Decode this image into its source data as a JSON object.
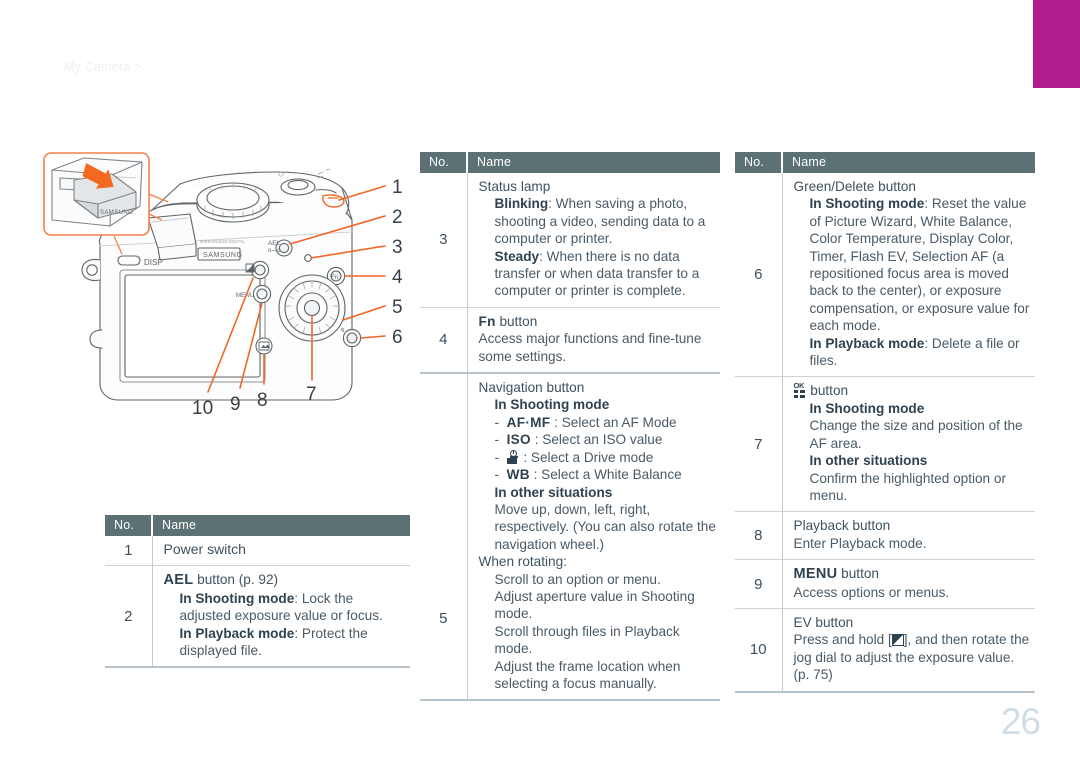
{
  "header": {
    "breadcrumb": "My Camera >"
  },
  "page_number": "26",
  "colors": {
    "accent": "#b01b8e",
    "table_header": "#5c7173",
    "callout": "#f06724",
    "page_num": "#cfdde6"
  },
  "illustration": {
    "name": "camera-rear-view-diagram",
    "brand_label": "SAMSUNG",
    "inset_brand_label": "SAMSUNG",
    "body_labels": [
      "AEL",
      "DISP",
      "MENU",
      "Fn"
    ],
    "callouts": [
      "1",
      "2",
      "3",
      "4",
      "5",
      "6",
      "7",
      "8",
      "9",
      "10"
    ]
  },
  "tables": {
    "columns": {
      "no": "No.",
      "name": "Name"
    },
    "left": {
      "name": "bottom-left-table",
      "rows": [
        {
          "no": "1",
          "title": "Power switch",
          "lines": []
        },
        {
          "no": "2",
          "title_kw": "AEL",
          "title_rest": " button (p. 92)",
          "lines": [
            {
              "label": "In Shooting mode",
              "text": ": Lock the adjusted exposure value or focus."
            },
            {
              "label": "In Playback mode",
              "text": ": Protect the displayed file."
            }
          ]
        }
      ]
    },
    "middle": {
      "name": "middle-table",
      "rows": [
        {
          "no": "3",
          "title": "Status lamp",
          "lines": [
            {
              "label": "Blinking",
              "text": ": When saving a photo, shooting a video, sending data to a computer or printer."
            },
            {
              "label": "Steady",
              "text": ": When there is no data transfer or when data transfer to a computer or printer is complete."
            }
          ]
        },
        {
          "no": "4",
          "title_kw": "Fn",
          "title_rest": " button",
          "lines": [
            {
              "label": "",
              "text": "Access major functions and fine-tune some settings."
            }
          ]
        },
        {
          "no": "5",
          "title": "Navigation button",
          "groups": [
            {
              "heading": "In Shooting mode",
              "bullets": [
                {
                  "kw": "AF·MF",
                  "text": " : Select an AF Mode"
                },
                {
                  "kw": "ISO",
                  "text": " : Select an ISO value"
                },
                {
                  "kw": "__DRIVE_ICON__",
                  "text": " : Select a Drive mode"
                },
                {
                  "kw": "WB",
                  "text": " : Select a White Balance"
                }
              ]
            },
            {
              "heading": "In other situations",
              "text": "Move up, down, left, right, respectively. (You can also rotate the navigation wheel.)"
            },
            {
              "heading_plain": "When rotating:",
              "items": [
                "Scroll to an option or menu.",
                "Adjust aperture value in Shooting mode.",
                "Scroll through files in Playback mode.",
                "Adjust the frame location when selecting a focus manually."
              ]
            }
          ]
        }
      ]
    },
    "right": {
      "name": "right-table",
      "rows": [
        {
          "no": "6",
          "title": "Green/Delete button",
          "lines": [
            {
              "label": "In Shooting mode",
              "text": ": Reset the value of Picture Wizard, White Balance, Color Temperature, Display Color, Timer, Flash EV, Selection AF (a repositioned focus area is moved back to the center), or exposure compensation, or exposure value for each mode."
            },
            {
              "label": "In Playback mode",
              "text": ": Delete a file or files."
            }
          ]
        },
        {
          "no": "7",
          "title_icon": "ok-button-icon",
          "title_rest": " button",
          "groups": [
            {
              "heading": "In Shooting mode",
              "text": "Change the size and position of the AF area."
            },
            {
              "heading": "In other situations",
              "text": "Confirm the highlighted option or menu."
            }
          ]
        },
        {
          "no": "8",
          "title": "Playback button",
          "lines": [
            {
              "label": "",
              "text": "Enter Playback mode."
            }
          ]
        },
        {
          "no": "9",
          "title_kw": "MENU",
          "title_rest": " button",
          "lines": [
            {
              "label": "",
              "text": "Access options or menus."
            }
          ]
        },
        {
          "no": "10",
          "title": "EV button",
          "lines": [
            {
              "label": "",
              "text_pre": "Press and hold [",
              "icon": "ev-icon",
              "text_post": "], and then rotate the jog dial to adjust the exposure value. (p. 75)"
            }
          ]
        }
      ]
    }
  }
}
